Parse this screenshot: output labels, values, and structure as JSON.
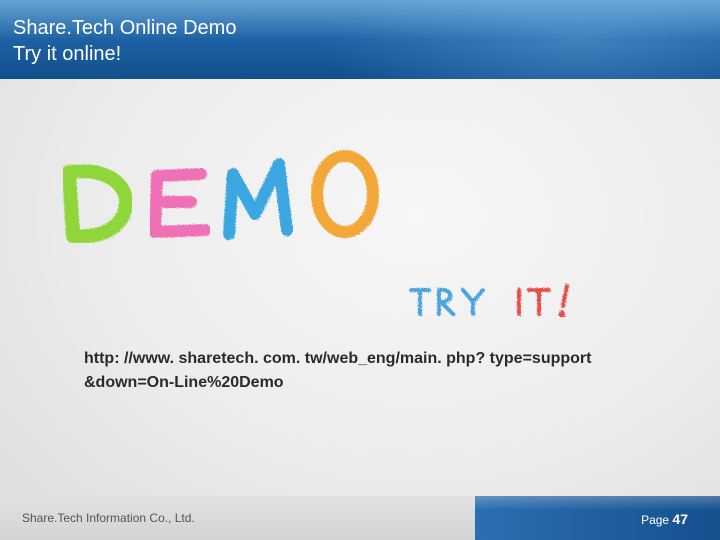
{
  "header": {
    "title": "Share.Tech Online Demo",
    "subtitle": "Try it online!"
  },
  "artwork": {
    "demo_word": "DEMO",
    "try_it": "TRY IT!",
    "colors": {
      "D": "#8fd63a",
      "E": "#f06fb6",
      "M": "#3aa6e0",
      "O": "#f2a838",
      "try": "#4aa4e0",
      "it": "#e8504a"
    }
  },
  "main": {
    "url_line_1": "http: //www. sharetech. com. tw/web_eng/main. php? type=support",
    "url_line_2": "&down=On-Line%20Demo"
  },
  "footer": {
    "company": "Share.Tech Information Co., Ltd.",
    "page_label": "Page",
    "page_number": "47"
  },
  "theme": {
    "header_blue": "#1f64a6",
    "footer_blue": "#15508f"
  }
}
